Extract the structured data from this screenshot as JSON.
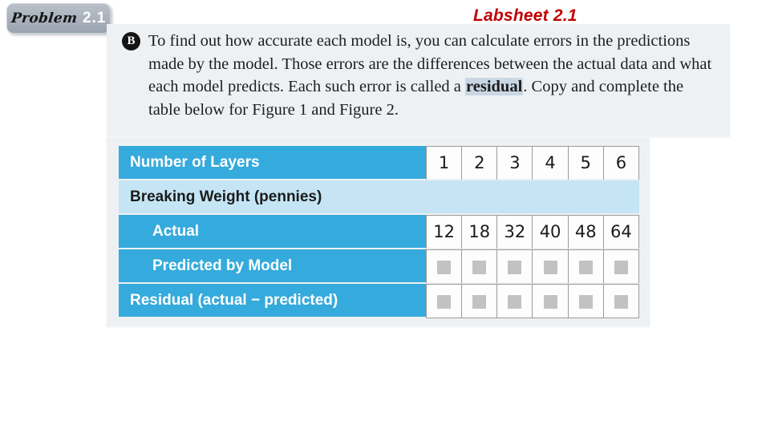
{
  "badge": {
    "word": "Problem",
    "number": "2.1"
  },
  "title": "Labsheet 2.1",
  "body": {
    "bullet": "B",
    "part1": "To find out how accurate each model is, you can calculate errors in the predictions made by the model. Those errors are the differences between the actual data and what each model predicts. Each such error is called a ",
    "highlight": "residual",
    "part2": ". Copy and complete the table below for Figure 1 and Figure 2."
  },
  "table": {
    "rows": [
      {
        "label": "Number of Layers",
        "style": "header-blue",
        "indent": false,
        "values": [
          "1",
          "2",
          "3",
          "4",
          "5",
          "6"
        ]
      },
      {
        "label": "Breaking Weight (pennies)",
        "style": "light-blue",
        "indent": false,
        "values": [
          "",
          "",
          "",
          "",
          "",
          ""
        ]
      },
      {
        "label": "Actual",
        "style": "header-blue",
        "indent": true,
        "values": [
          "12",
          "18",
          "32",
          "40",
          "48",
          "64"
        ]
      },
      {
        "label": "Predicted by Model",
        "style": "header-blue",
        "indent": true,
        "values": [
          "blank",
          "blank",
          "blank",
          "blank",
          "blank",
          "blank"
        ]
      },
      {
        "label": "Residual (actual − predicted)",
        "style": "header-blue",
        "indent": false,
        "values": [
          "blank",
          "blank",
          "blank",
          "blank",
          "blank",
          "blank"
        ]
      }
    ]
  },
  "colors": {
    "accent_blue": "#35aadc",
    "light_blue": "#c5e5f5",
    "title_red": "#c00000",
    "panel_gray": "#eef1f4",
    "blank_box": "#c2c2c2"
  }
}
